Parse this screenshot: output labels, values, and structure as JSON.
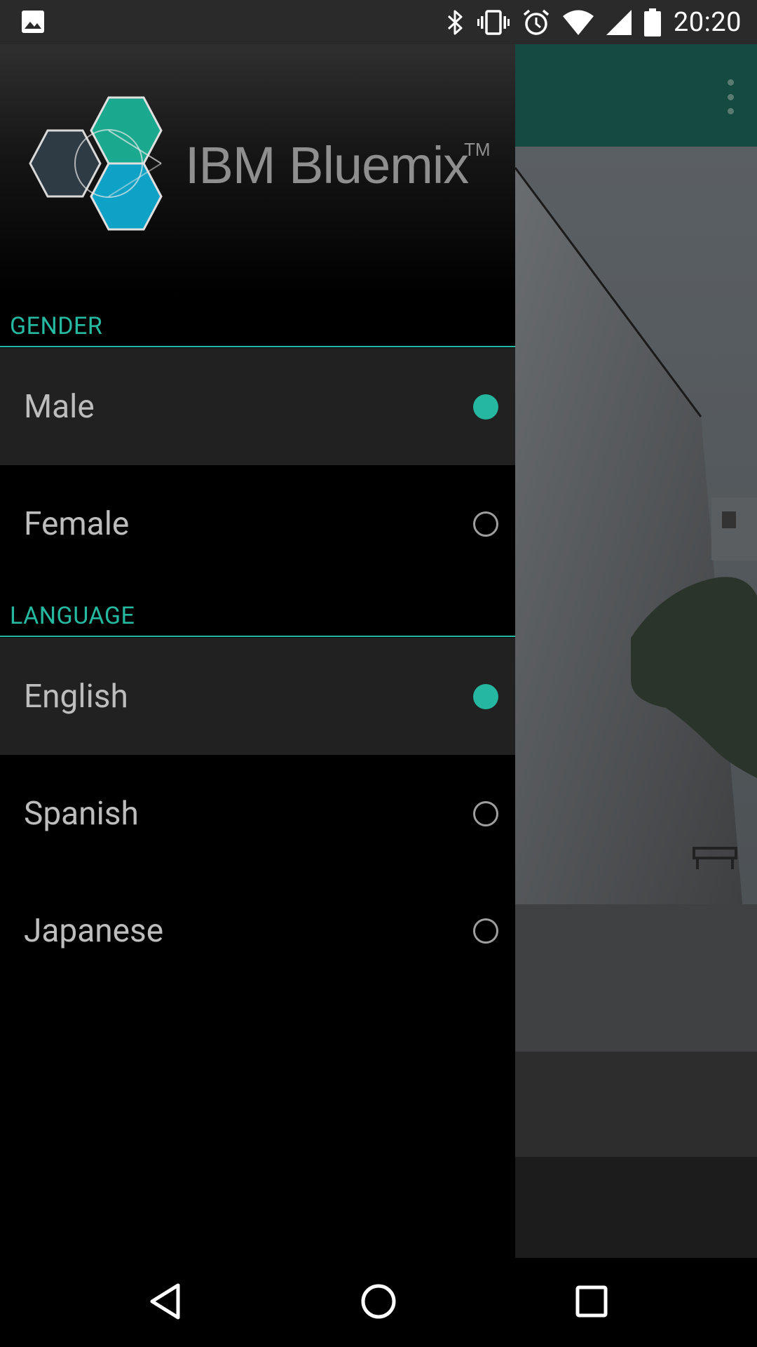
{
  "status_bar": {
    "time": "20:20",
    "icons": [
      "gallery-icon",
      "bluetooth-icon",
      "vibrate-icon",
      "alarm-icon",
      "wifi-icon",
      "signal-icon",
      "battery-icon"
    ]
  },
  "app": {
    "overflow_icon": "more-vert-icon",
    "toolbar_color": "#154a40"
  },
  "drawer": {
    "brand": {
      "name": "IBM Bluemix",
      "trademark": "TM"
    },
    "sections": [
      {
        "title": "GENDER",
        "options": [
          {
            "label": "Male",
            "selected": true
          },
          {
            "label": "Female",
            "selected": false
          }
        ]
      },
      {
        "title": "LANGUAGE",
        "options": [
          {
            "label": "English",
            "selected": true
          },
          {
            "label": "Spanish",
            "selected": false
          },
          {
            "label": "Japanese",
            "selected": false
          }
        ]
      }
    ],
    "accent_color": "#26b7a0"
  },
  "nav_bar": {
    "buttons": [
      "back-icon",
      "home-icon",
      "recents-icon"
    ]
  }
}
